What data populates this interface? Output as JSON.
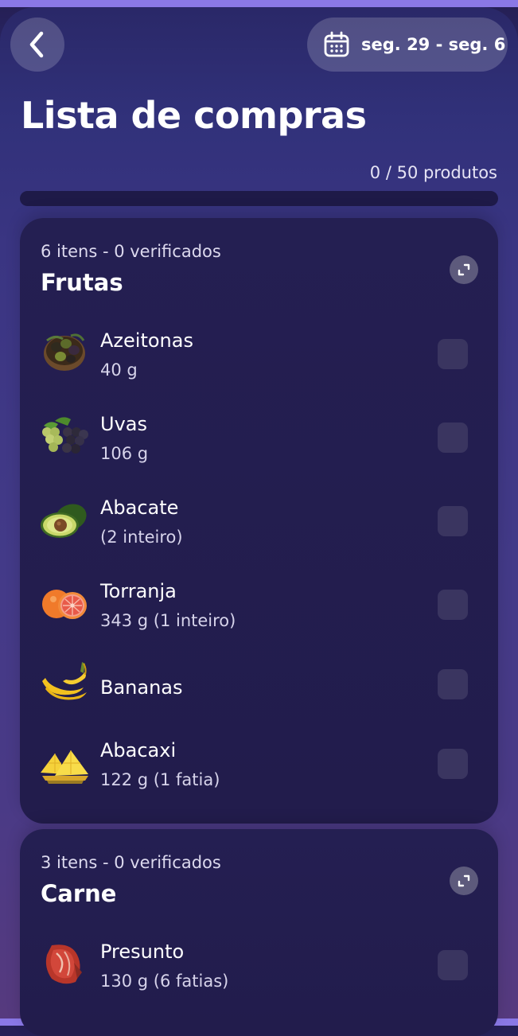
{
  "header": {
    "back_icon": "chevron-left-icon",
    "calendar_icon": "calendar-icon",
    "date_range": "seg. 29 - seg. 6"
  },
  "page": {
    "title": "Lista de compras",
    "progress_text": "0 / 50 produtos",
    "progress_fraction": 0
  },
  "categories": [
    {
      "summary": "6 itens - 0 verificados",
      "title": "Frutas",
      "expand_icon": "expand-icon",
      "items": [
        {
          "name": "Azeitonas",
          "qty": "40 g",
          "icon": "olives-image",
          "checked": false
        },
        {
          "name": "Uvas",
          "qty": "106 g",
          "icon": "grapes-image",
          "checked": false
        },
        {
          "name": "Abacate",
          "qty": "(2 inteiro)",
          "icon": "avocado-image",
          "checked": false
        },
        {
          "name": "Torranja",
          "qty": "343 g  (1 inteiro)",
          "icon": "grapefruit-image",
          "checked": false
        },
        {
          "name": "Bananas",
          "qty": "",
          "icon": "banana-image",
          "checked": false
        },
        {
          "name": "Abacaxi",
          "qty": "122 g  (1 fatia)",
          "icon": "pineapple-image",
          "checked": false
        }
      ]
    },
    {
      "summary": "3 itens - 0 verificados",
      "title": "Carne",
      "expand_icon": "expand-icon",
      "items": [
        {
          "name": "Presunto",
          "qty": "130 g  (6 fatias)",
          "icon": "ham-image",
          "checked": false
        }
      ]
    }
  ],
  "colors": {
    "accent": "#8f7bff",
    "card_bg": "#231d4f",
    "checkbox_bg": "#3a3560"
  }
}
